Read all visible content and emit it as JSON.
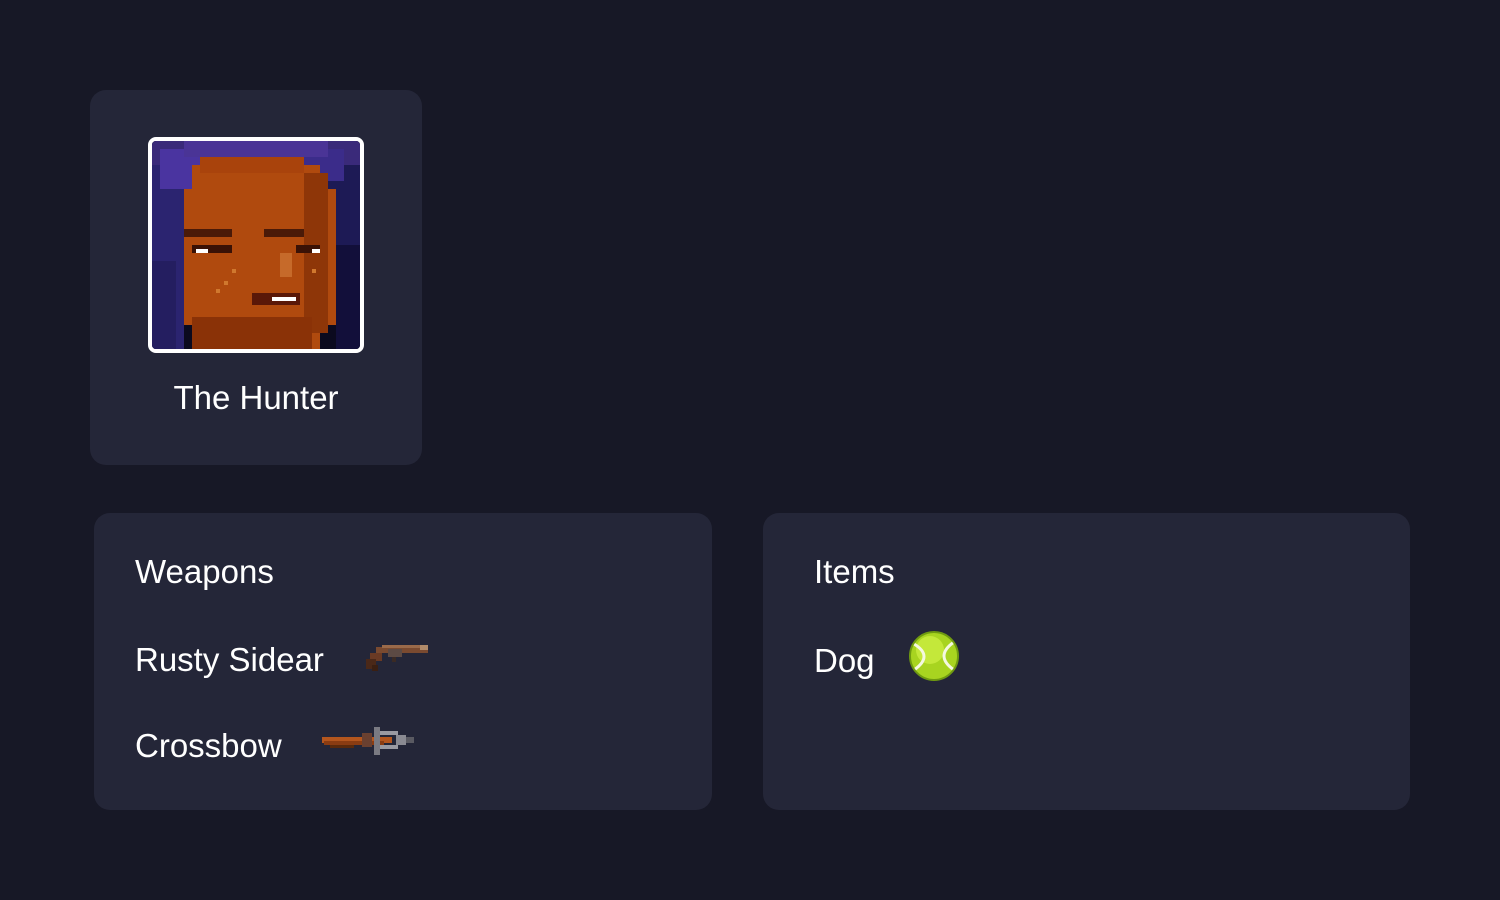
{
  "character": {
    "name": "The Hunter",
    "portrait_icon": "hunter-portrait-icon"
  },
  "weapons": {
    "title": "Weapons",
    "items": [
      {
        "label": "Rusty Sidear",
        "icon": "revolver-icon"
      },
      {
        "label": "Crossbow",
        "icon": "crossbow-icon"
      }
    ]
  },
  "items": {
    "title": "Items",
    "items": [
      {
        "label": "Dog",
        "icon": "tennis-ball-icon"
      }
    ]
  },
  "colors": {
    "background": "#171826",
    "card": "#242638",
    "text": "#ffffff",
    "portrait_border": "#ffffff"
  }
}
